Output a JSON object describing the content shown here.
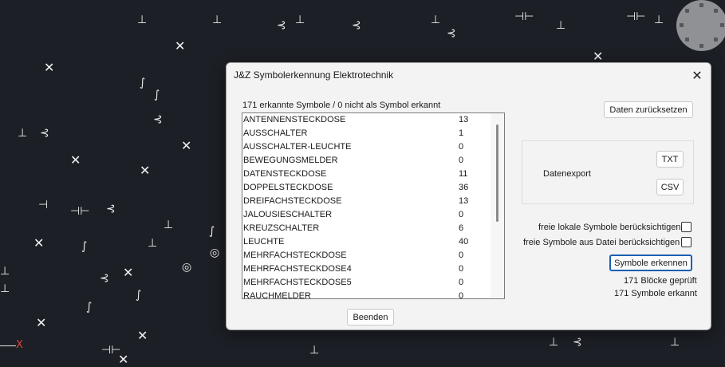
{
  "dialog": {
    "title": "J&Z Symbolerkennung Elektrotechnik",
    "summary": "171 erkannte Symbole / 0 nicht als Symbol erkannt",
    "reset_label": "Daten zurücksetzen",
    "export_group_label": "Datenexport",
    "txt_label": "TXT",
    "csv_label": "CSV",
    "option_local_label": "freie lokale Symbole berücksichtigen",
    "option_file_label": "freie Symbole aus Datei berücksichtigen",
    "option_local_checked": false,
    "option_file_checked": false,
    "recognize_label": "Symbole erkennen",
    "status_blocks": "171 Blöcke geprüft",
    "status_symbols": "171 Symbole erkannt",
    "close_label": "Beenden"
  },
  "symbols": [
    {
      "name": "ANTENNENSTECKDOSE",
      "count": "13"
    },
    {
      "name": "AUSSCHALTER",
      "count": "1"
    },
    {
      "name": "AUSSCHALTER-LEUCHTE",
      "count": "0"
    },
    {
      "name": "BEWEGUNGSMELDER",
      "count": "0"
    },
    {
      "name": "DATENSTECKDOSE",
      "count": "11"
    },
    {
      "name": "DOPPELSTECKDOSE",
      "count": "36"
    },
    {
      "name": "DREIFACHSTECKDOSE",
      "count": "13"
    },
    {
      "name": "JALOUSIESCHALTER",
      "count": "0"
    },
    {
      "name": "KREUZSCHALTER",
      "count": "6"
    },
    {
      "name": "LEUCHTE",
      "count": "40"
    },
    {
      "name": "MEHRFACHSTECKDOSE",
      "count": "0"
    },
    {
      "name": "MEHRFACHSTECKDOSE4",
      "count": "0"
    },
    {
      "name": "MEHRFACHSTECKDOSE5",
      "count": "0"
    },
    {
      "name": "RAUCHMELDER",
      "count": "0"
    }
  ],
  "canvas": {
    "axis_label": "X",
    "colors": {
      "background": "#1c1f25",
      "axis_x": "#e0453a",
      "linework": "#e8e8e8"
    }
  }
}
